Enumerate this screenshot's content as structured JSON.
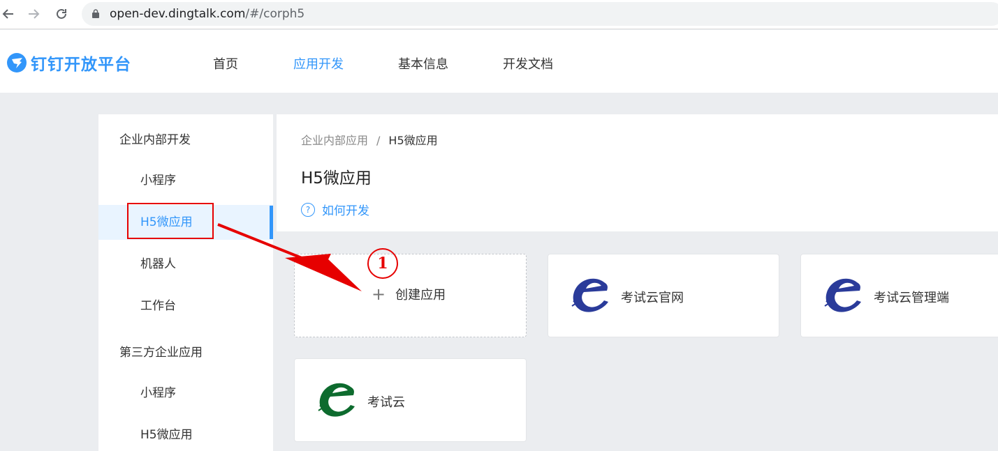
{
  "browser": {
    "back_icon": "arrow-left-icon",
    "forward_icon": "arrow-right-icon",
    "reload_icon": "reload-icon",
    "url_host": "open-dev.dingtalk.com",
    "url_path": "/#/corph5"
  },
  "header": {
    "logo_text": "钉钉开放平台",
    "nav": [
      "首页",
      "应用开发",
      "基本信息",
      "开发文档"
    ],
    "active_nav": "应用开发"
  },
  "sidebar": {
    "group1": "企业内部开发",
    "group1_items": [
      "小程序",
      "H5微应用",
      "机器人",
      "工作台"
    ],
    "group2": "第三方企业应用",
    "group2_items": [
      "小程序",
      "H5微应用"
    ],
    "active_item": "H5微应用"
  },
  "main": {
    "breadcrumb": [
      "企业内部应用",
      "H5微应用"
    ],
    "breadcrumb_sep": "/",
    "title": "H5微应用",
    "help_link": "如何开发",
    "create_label": "创建应用",
    "apps": [
      {
        "name": "考试云官网",
        "logo_color": "#2a3b9a"
      },
      {
        "name": "考试云管理端",
        "logo_color": "#2a3b9a"
      },
      {
        "name": "考试云",
        "logo_color": "#0d6b2e"
      }
    ]
  },
  "annotation": {
    "step_number": "1",
    "color": "#e60000"
  },
  "colors": {
    "accent": "#3296fa",
    "page_bg": "#ebedf0"
  }
}
